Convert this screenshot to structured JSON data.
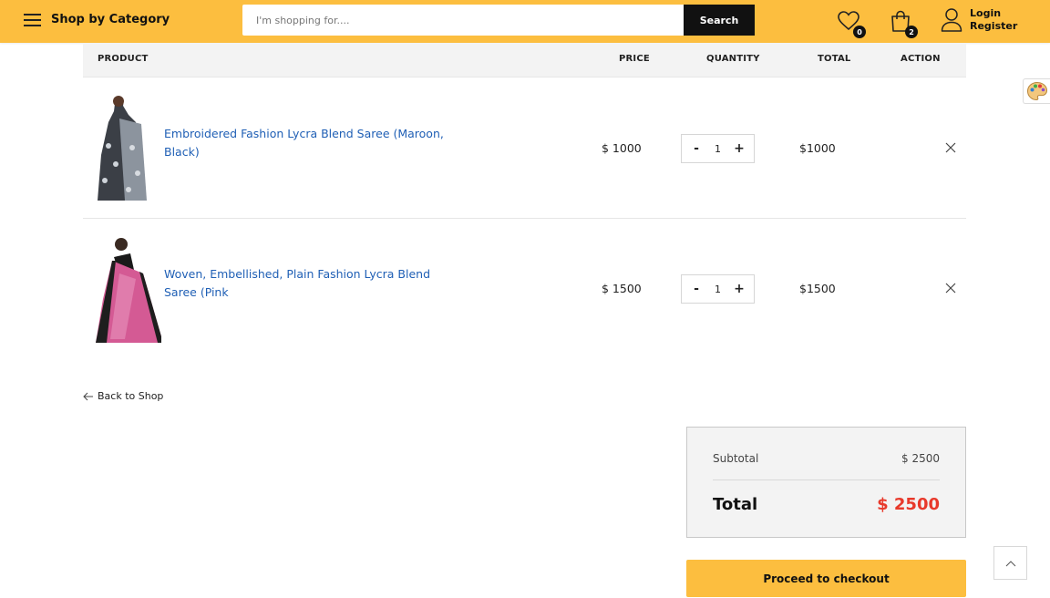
{
  "header": {
    "category_label": "Shop by Category",
    "search_placeholder": "I'm shopping for....",
    "search_button": "Search",
    "wishlist_count": "0",
    "cart_count": "2",
    "login": "Login",
    "register": "Register"
  },
  "table": {
    "headers": {
      "product": "PRODUCT",
      "price": "PRICE",
      "quantity": "QUANTITY",
      "total": "TOTAL",
      "action": "ACTION"
    },
    "rows": [
      {
        "name": "Embroidered Fashion Lycra Blend Saree (Maroon, Black)",
        "price": "$ 1000",
        "qty_minus": "-",
        "quantity": "1",
        "qty_plus": "+",
        "total": "$1000"
      },
      {
        "name": "Woven, Embellished, Plain Fashion Lycra Blend Saree (Pink",
        "price": "$ 1500",
        "qty_minus": "-",
        "quantity": "1",
        "qty_plus": "+",
        "total": "$1500"
      }
    ]
  },
  "back_to_shop": "Back to Shop",
  "summary": {
    "subtotal_label": "Subtotal",
    "subtotal_value": "$ 2500",
    "total_label": "Total",
    "total_value": "$ 2500",
    "checkout_label": "Proceed to checkout"
  },
  "colors": {
    "brand": "#fcbe3f",
    "link": "#1f5fb5",
    "total_red": "#e8392b"
  }
}
